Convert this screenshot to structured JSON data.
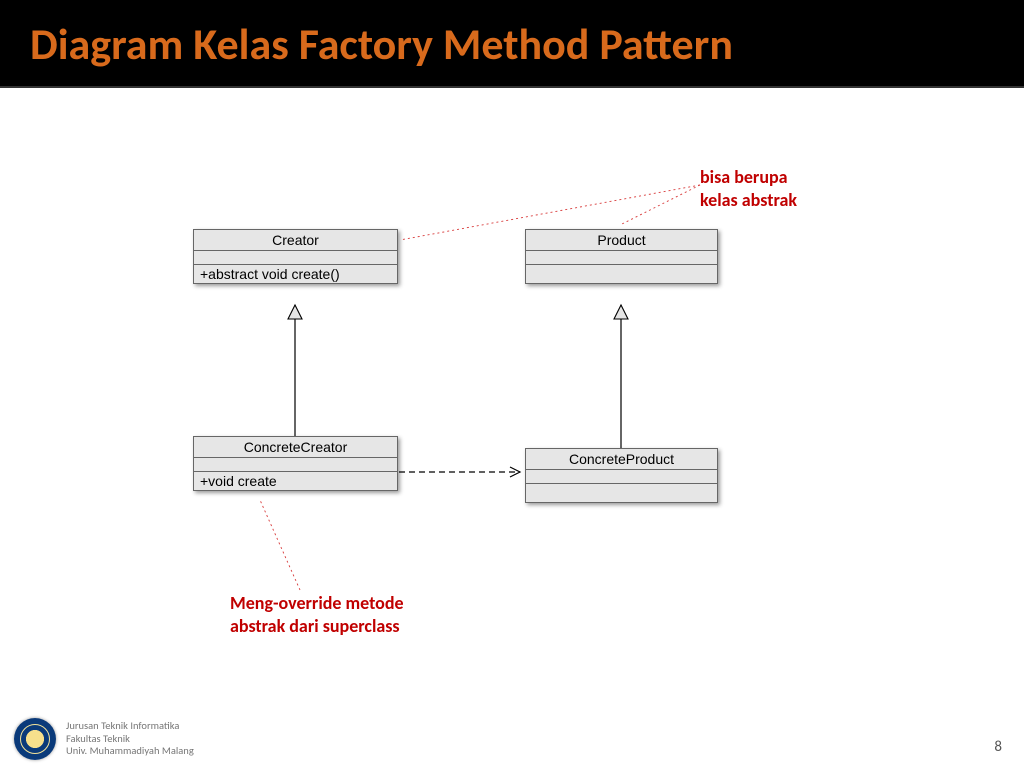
{
  "title": "Diagram Kelas Factory Method Pattern",
  "annotations": {
    "top": "bisa berupa\n kelas abstrak",
    "bottom": "Meng-override metode\nabstrak dari superclass"
  },
  "classes": {
    "creator": {
      "name": "Creator",
      "attrs": "",
      "ops": "+abstract void create()"
    },
    "product": {
      "name": "Product",
      "attrs": "",
      "ops": ""
    },
    "concreteCreator": {
      "name": "ConcreteCreator",
      "attrs": "",
      "ops": "+void create"
    },
    "concreteProduct": {
      "name": "ConcreteProduct",
      "attrs": "",
      "ops": ""
    }
  },
  "footer": {
    "line1": "Jurusan Teknik Informatika",
    "line2": "Fakultas Teknik",
    "line3": "Univ. Muhammadiyah Malang"
  },
  "pageNumber": "8"
}
